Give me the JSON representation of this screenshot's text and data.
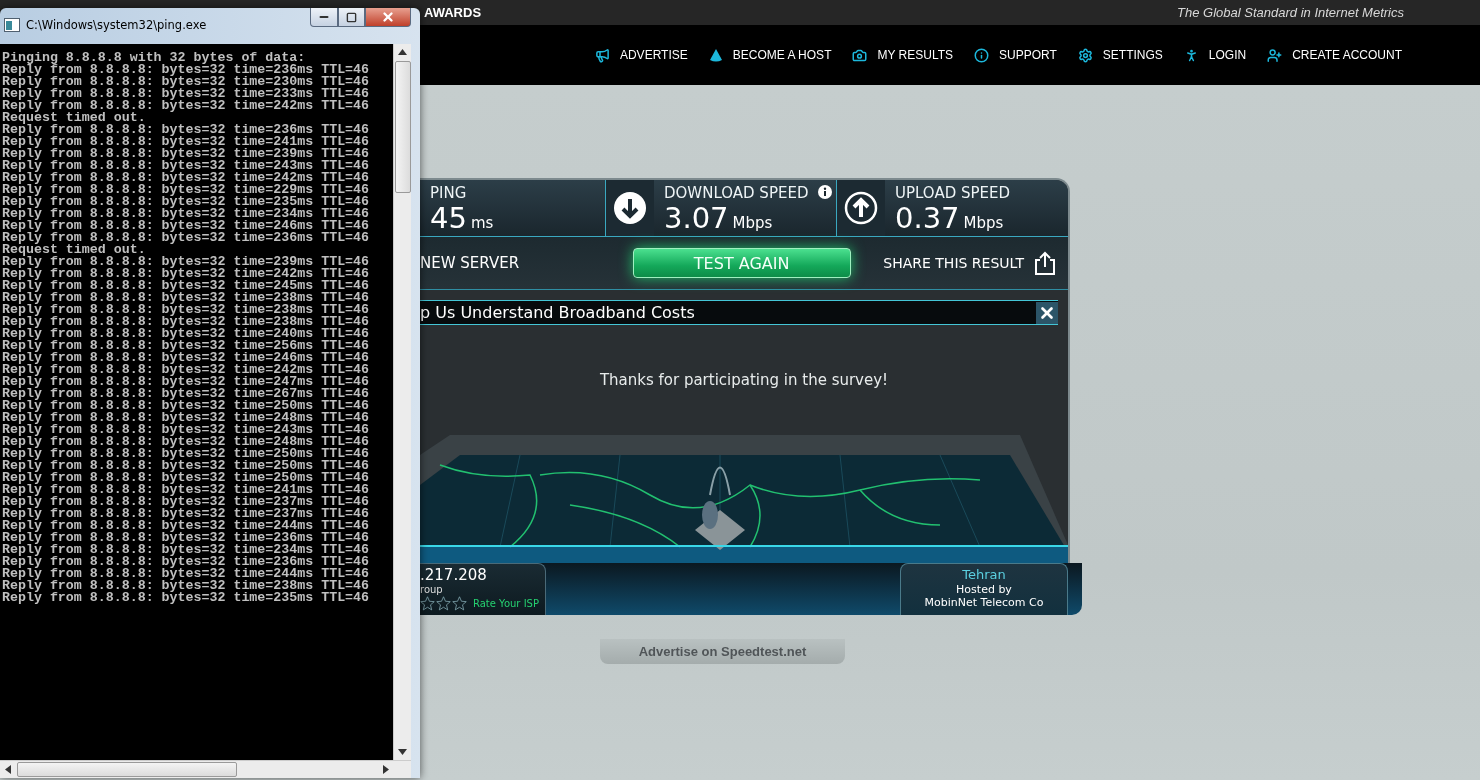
{
  "top_bar": {
    "nav_item": "AWARDS",
    "tagline": "The Global Standard in Internet Metrics"
  },
  "nav": [
    {
      "label": "ADVERTISE",
      "kind": "megaphone"
    },
    {
      "label": "BECOME A HOST",
      "kind": "cone"
    },
    {
      "label": "MY RESULTS",
      "kind": "camera"
    },
    {
      "label": "SUPPORT",
      "kind": "info"
    },
    {
      "label": "SETTINGS",
      "kind": "gear"
    },
    {
      "label": "LOGIN",
      "kind": "person"
    },
    {
      "label": "CREATE ACCOUNT",
      "kind": "person-add"
    }
  ],
  "results": [
    {
      "kind": "ping",
      "label": "PING",
      "value": "45",
      "unit": "ms"
    },
    {
      "kind": "download",
      "label": "DOWNLOAD SPEED",
      "value": "3.07",
      "unit": "Mbps"
    },
    {
      "kind": "upload",
      "label": "UPLOAD SPEED",
      "value": "0.37",
      "unit": "Mbps"
    }
  ],
  "actions": {
    "new_server": "NEW SERVER",
    "test_again": "TEST AGAIN",
    "share": "SHARE THIS RESULT"
  },
  "survey": {
    "title": "p Us Understand Broadband Costs",
    "message": "Thanks for participating in the survey!"
  },
  "isp": {
    "ip": ".217.208",
    "name": "roup",
    "stars": 0,
    "rate": "Rate Your ISP"
  },
  "server": {
    "city": "Tehran",
    "hosted_by": "Hosted by",
    "host": "MobinNet Telecom Co"
  },
  "advertise_tab": "Advertise on Speedtest.net",
  "console": {
    "title": "C:\\Windows\\system32\\ping.exe",
    "lines": [
      "Pinging 8.8.8.8 with 32 bytes of data:",
      "Reply from 8.8.8.8: bytes=32 time=236ms TTL=46",
      "Reply from 8.8.8.8: bytes=32 time=230ms TTL=46",
      "Reply from 8.8.8.8: bytes=32 time=233ms TTL=46",
      "Reply from 8.8.8.8: bytes=32 time=242ms TTL=46",
      "Request timed out.",
      "Reply from 8.8.8.8: bytes=32 time=236ms TTL=46",
      "Reply from 8.8.8.8: bytes=32 time=241ms TTL=46",
      "Reply from 8.8.8.8: bytes=32 time=239ms TTL=46",
      "Reply from 8.8.8.8: bytes=32 time=243ms TTL=46",
      "Reply from 8.8.8.8: bytes=32 time=242ms TTL=46",
      "Reply from 8.8.8.8: bytes=32 time=229ms TTL=46",
      "Reply from 8.8.8.8: bytes=32 time=235ms TTL=46",
      "Reply from 8.8.8.8: bytes=32 time=234ms TTL=46",
      "Reply from 8.8.8.8: bytes=32 time=246ms TTL=46",
      "Reply from 8.8.8.8: bytes=32 time=236ms TTL=46",
      "Request timed out.",
      "Reply from 8.8.8.8: bytes=32 time=239ms TTL=46",
      "Reply from 8.8.8.8: bytes=32 time=242ms TTL=46",
      "Reply from 8.8.8.8: bytes=32 time=245ms TTL=46",
      "Reply from 8.8.8.8: bytes=32 time=238ms TTL=46",
      "Reply from 8.8.8.8: bytes=32 time=238ms TTL=46",
      "Reply from 8.8.8.8: bytes=32 time=238ms TTL=46",
      "Reply from 8.8.8.8: bytes=32 time=240ms TTL=46",
      "Reply from 8.8.8.8: bytes=32 time=256ms TTL=46",
      "Reply from 8.8.8.8: bytes=32 time=246ms TTL=46",
      "Reply from 8.8.8.8: bytes=32 time=242ms TTL=46",
      "Reply from 8.8.8.8: bytes=32 time=247ms TTL=46",
      "Reply from 8.8.8.8: bytes=32 time=267ms TTL=46",
      "Reply from 8.8.8.8: bytes=32 time=250ms TTL=46",
      "Reply from 8.8.8.8: bytes=32 time=248ms TTL=46",
      "Reply from 8.8.8.8: bytes=32 time=243ms TTL=46",
      "Reply from 8.8.8.8: bytes=32 time=248ms TTL=46",
      "Reply from 8.8.8.8: bytes=32 time=250ms TTL=46",
      "Reply from 8.8.8.8: bytes=32 time=250ms TTL=46",
      "Reply from 8.8.8.8: bytes=32 time=250ms TTL=46",
      "Reply from 8.8.8.8: bytes=32 time=241ms TTL=46",
      "Reply from 8.8.8.8: bytes=32 time=237ms TTL=46",
      "Reply from 8.8.8.8: bytes=32 time=237ms TTL=46",
      "Reply from 8.8.8.8: bytes=32 time=244ms TTL=46",
      "Reply from 8.8.8.8: bytes=32 time=236ms TTL=46",
      "Reply from 8.8.8.8: bytes=32 time=234ms TTL=46",
      "Reply from 8.8.8.8: bytes=32 time=236ms TTL=46",
      "Reply from 8.8.8.8: bytes=32 time=244ms TTL=46",
      "Reply from 8.8.8.8: bytes=32 time=238ms TTL=46",
      "Reply from 8.8.8.8: bytes=32 time=235ms TTL=46"
    ]
  }
}
